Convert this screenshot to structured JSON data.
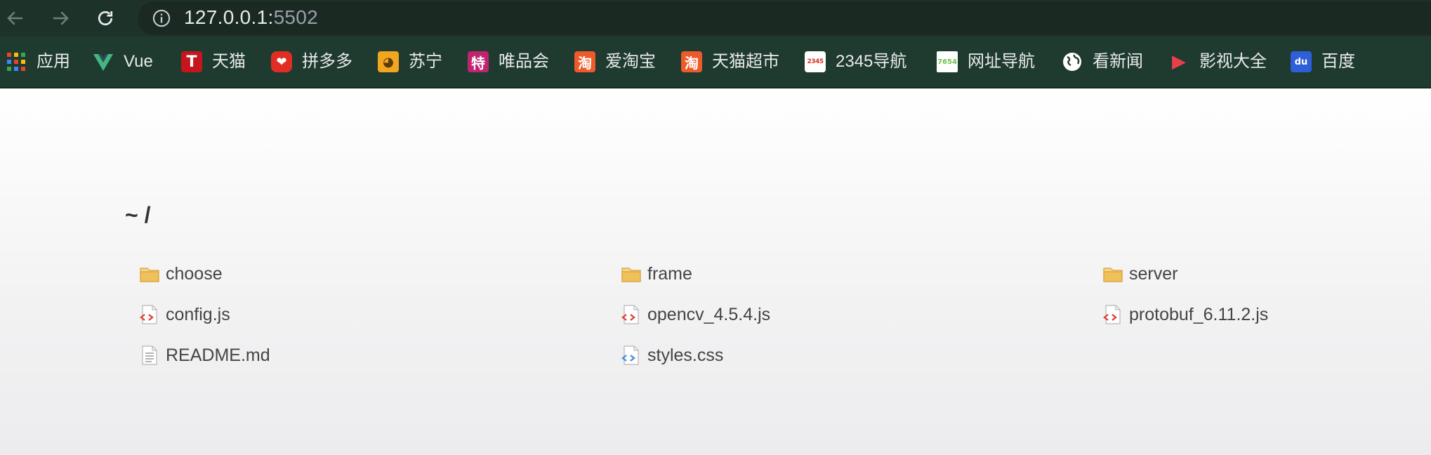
{
  "browser": {
    "url_host": "127.0.0.1:",
    "url_port": "5502"
  },
  "bookmarks": [
    {
      "label": "应用",
      "icon": "apps-grid-icon",
      "glyph": ""
    },
    {
      "label": "Vue",
      "icon": "vue-logo-icon",
      "glyph": "V"
    },
    {
      "label": "天猫",
      "icon": "tmall-icon",
      "glyph": "T"
    },
    {
      "label": "拼多多",
      "icon": "pinduoduo-icon",
      "glyph": "❤"
    },
    {
      "label": "苏宁",
      "icon": "suning-icon",
      "glyph": "◕"
    },
    {
      "label": "唯品会",
      "icon": "vip-icon",
      "glyph": "特"
    },
    {
      "label": "爱淘宝",
      "icon": "taobao-icon",
      "glyph": "淘"
    },
    {
      "label": "天猫超市",
      "icon": "taobao-icon",
      "glyph": "淘"
    },
    {
      "label": "2345导航",
      "icon": "2345-icon",
      "glyph": "2345"
    },
    {
      "label": "网址导航",
      "icon": "7654-icon",
      "glyph": "7654"
    },
    {
      "label": "看新闻",
      "icon": "globe-icon",
      "glyph": ""
    },
    {
      "label": "影视大全",
      "icon": "play-icon",
      "glyph": "▶"
    },
    {
      "label": "百度",
      "icon": "baidu-icon",
      "glyph": "du"
    }
  ],
  "page": {
    "title": "~ /"
  },
  "files": [
    {
      "name": "choose",
      "type": "folder",
      "icon": "folder-icon"
    },
    {
      "name": "frame",
      "type": "folder",
      "icon": "folder-icon"
    },
    {
      "name": "server",
      "type": "folder",
      "icon": "folder-icon"
    },
    {
      "name": "config.js",
      "type": "js",
      "icon": "js-file-icon"
    },
    {
      "name": "opencv_4.5.4.js",
      "type": "js",
      "icon": "js-file-icon"
    },
    {
      "name": "protobuf_6.11.2.js",
      "type": "js",
      "icon": "js-file-icon"
    },
    {
      "name": "README.md",
      "type": "text",
      "icon": "text-file-icon"
    },
    {
      "name": "styles.css",
      "type": "css",
      "icon": "css-file-icon"
    }
  ],
  "colors": {
    "toolbar_bg": "#1d3229",
    "bookmarks_bg": "#1f3a2e",
    "folder": "#f0c15b",
    "js_accent": "#e0433a",
    "css_accent": "#4a90d9"
  }
}
